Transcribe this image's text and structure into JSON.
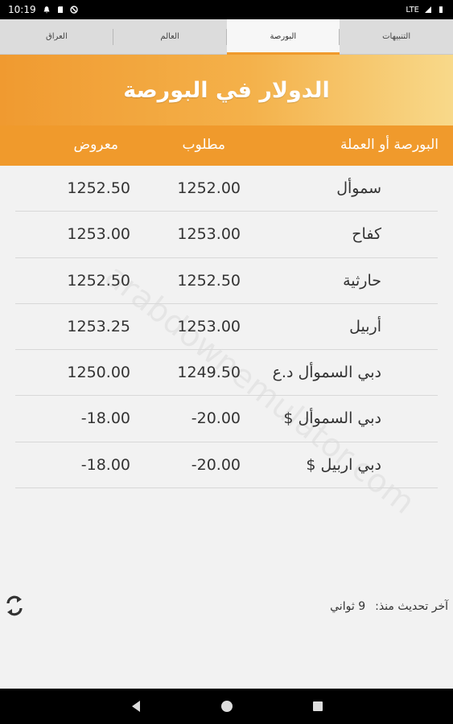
{
  "status_bar": {
    "time": "10:19",
    "network": "LTE"
  },
  "tabs": [
    {
      "label": "التنبيهات",
      "active": false
    },
    {
      "label": "البورصة",
      "active": true
    },
    {
      "label": "العالم",
      "active": false
    },
    {
      "label": "العراق",
      "active": false
    }
  ],
  "banner": {
    "title": "الدولار في البورصة"
  },
  "table": {
    "headers": {
      "name": "البورصة أو العملة",
      "bid": "مطلوب",
      "ask": "معروض"
    },
    "rows": [
      {
        "name": "سموأل",
        "bid": "1252.00",
        "ask": "1252.50"
      },
      {
        "name": "كفاح",
        "bid": "1253.00",
        "ask": "1253.00"
      },
      {
        "name": "حارثية",
        "bid": "1252.50",
        "ask": "1252.50"
      },
      {
        "name": "أربيل",
        "bid": "1253.00",
        "ask": "1253.25"
      },
      {
        "name": "دبي السموأل د.ع",
        "bid": "1249.50",
        "ask": "1250.00"
      },
      {
        "name": "دبي السموأل $",
        "bid": "-20.00",
        "ask": "-18.00"
      },
      {
        "name": "دبي اربيل $",
        "bid": "-20.00",
        "ask": "-18.00"
      }
    ]
  },
  "footer": {
    "last_update_label": "آخر تحديث منذ:",
    "last_update_value": "9 ثواني"
  },
  "watermark": "arabdownemulator.com",
  "colors": {
    "accent": "#f09a2c",
    "banner_start": "#f09a30",
    "banner_end": "#f8d98a"
  }
}
